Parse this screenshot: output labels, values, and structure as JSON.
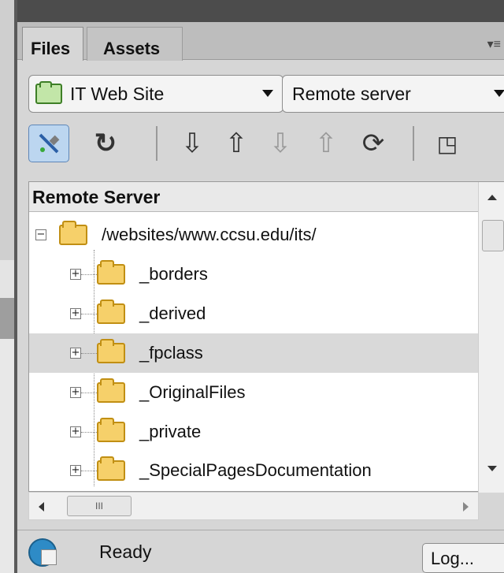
{
  "tabs": [
    {
      "label": "Files",
      "active": true
    },
    {
      "label": "Assets",
      "active": false
    }
  ],
  "panel_menu_icon": "panel-options-icon",
  "site_select": {
    "value": "IT Web Site",
    "icon": "site-icon"
  },
  "view_select": {
    "value": "Remote server"
  },
  "toolbar": {
    "buttons": [
      "connect-icon",
      "refresh-icon",
      "get-files-icon",
      "put-files-icon",
      "check-out-icon",
      "check-in-icon",
      "synchronize-icon",
      "expand-icon"
    ]
  },
  "tree": {
    "header": "Remote Server",
    "root": "/websites/www.ccsu.edu/its/",
    "items": [
      {
        "name": "_borders"
      },
      {
        "name": "_derived"
      },
      {
        "name": "_fpclass",
        "selected": true
      },
      {
        "name": "_OriginalFiles"
      },
      {
        "name": "_private"
      },
      {
        "name": "_SpecialPagesDocumentation"
      }
    ],
    "expand_symbol": "+",
    "collapse_symbol": "−"
  },
  "status": {
    "text": "Ready",
    "log_button": "Log..."
  },
  "colors": {
    "selected_row": "#d9d9d9",
    "folder": "#f6d06a",
    "connect_button": "#bcd6f0"
  }
}
